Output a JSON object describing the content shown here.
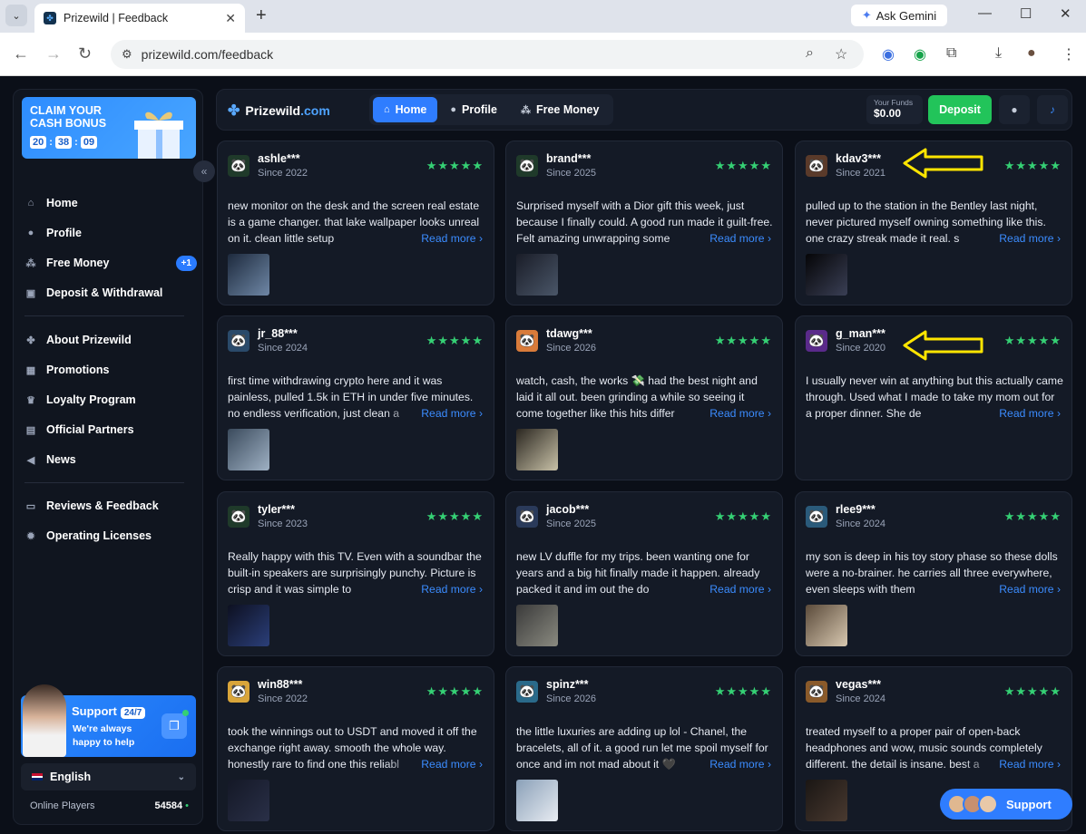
{
  "browser": {
    "tab_title": "Prizewild | Feedback",
    "url": "prizewild.com/feedback",
    "gemini_label": "Ask Gemini"
  },
  "sidebar": {
    "bonus_title": "CLAIM YOUR CASH BONUS",
    "timer": [
      "20",
      "38",
      "09"
    ],
    "items": [
      {
        "label": "Home",
        "icon": "home-icon"
      },
      {
        "label": "Profile",
        "icon": "user-icon"
      },
      {
        "label": "Free Money",
        "icon": "coins-icon",
        "badge": "+1"
      },
      {
        "label": "Deposit & Withdrawal",
        "icon": "wallet-icon"
      },
      {
        "label": "About Prizewild",
        "icon": "clover-icon"
      },
      {
        "label": "Promotions",
        "icon": "gift-icon"
      },
      {
        "label": "Loyalty Program",
        "icon": "trophy-icon"
      },
      {
        "label": "Official Partners",
        "icon": "briefcase-icon"
      },
      {
        "label": "News",
        "icon": "megaphone-icon"
      },
      {
        "label": "Reviews & Feedback",
        "icon": "chat-icon"
      },
      {
        "label": "Operating Licenses",
        "icon": "badge-icon"
      }
    ],
    "support_title": "Support",
    "support_badge": "24/7",
    "support_sub": "We're always happy to help",
    "language": "English",
    "online_label": "Online Players",
    "online_count": "54584"
  },
  "topbar": {
    "logo_main": "Prizewild",
    "logo_suffix": ".com",
    "tabs": [
      {
        "label": "Home",
        "icon": "home-icon",
        "active": true
      },
      {
        "label": "Profile",
        "icon": "user-icon",
        "active": false
      },
      {
        "label": "Free Money",
        "icon": "coins-icon",
        "active": false
      }
    ],
    "funds_label": "Your Funds",
    "funds_value": "$0.00",
    "deposit_label": "Deposit"
  },
  "reviews": [
    {
      "user": "ashle***",
      "since": "Since 2022",
      "text": "new monitor on the desk and the screen real estate is a game changer. that lake wallpaper looks unreal on it. clean little setup",
      "avatar_color": "#1f3a2a",
      "thumb_colors": [
        "#1d2a3d",
        "#6f87a6"
      ]
    },
    {
      "user": "brand***",
      "since": "Since 2025",
      "text": "Surprised myself with a Dior gift this week, just because I finally could. A good run made it guilt-free. Felt amazing unwrapping some",
      "avatar_color": "#1f3a2a",
      "thumb_colors": [
        "#1a1d28",
        "#4a5668"
      ]
    },
    {
      "user": "kdav3***",
      "since": "Since 2021",
      "text": "pulled up to the station in the Bentley last night, never pictured myself owning something like this. one crazy streak made it real. s",
      "avatar_color": "#5a3a2a",
      "thumb_colors": [
        "#050507",
        "#3a3f55"
      ]
    },
    {
      "user": "jr_88***",
      "since": "Since 2024",
      "text": "first time withdrawing crypto here and it was painless, pulled 1.5k in ETH in under five minutes. no endless verification, just clean a",
      "avatar_color": "#2a4a6a",
      "thumb_colors": [
        "#3a4a5c",
        "#9fb1c4"
      ]
    },
    {
      "user": "tdawg***",
      "since": "Since 2026",
      "text": "watch, cash, the works 💸 had the best night and laid it all out. been grinding a while so seeing it come together like this hits differ",
      "avatar_color": "#d97b3a",
      "thumb_colors": [
        "#2a2620",
        "#c9c2a8"
      ]
    },
    {
      "user": "g_man***",
      "since": "Since 2020",
      "text": "I usually never win at anything but this actually came through. Used what I made to take my mom out for a proper dinner. She de",
      "avatar_color": "#5a2a8a",
      "thumb_colors": [
        "#141a26",
        "#141a26"
      ]
    },
    {
      "user": "tyler***",
      "since": "Since 2023",
      "text": "Really happy with this TV. Even with a soundbar the built-in speakers are surprisingly punchy. Picture is crisp and it was simple to",
      "avatar_color": "#1f3a2a",
      "thumb_colors": [
        "#0d1020",
        "#2b3f7a"
      ]
    },
    {
      "user": "jacob***",
      "since": "Since 2025",
      "text": "new LV duffle for my trips. been wanting one for years and a big hit finally made it happen. already packed it and im out the do",
      "avatar_color": "#2a3a5a",
      "thumb_colors": [
        "#3a3a3a",
        "#8a8a80"
      ]
    },
    {
      "user": "rlee9***",
      "since": "Since 2024",
      "text": "my son is deep in his toy story phase so these dolls were a no-brainer. he carries all three everywhere, even sleeps with them",
      "avatar_color": "#2a5a7a",
      "thumb_colors": [
        "#5a4a3a",
        "#d8c8b0"
      ]
    },
    {
      "user": "win88***",
      "since": "Since 2022",
      "text": "took the winnings out to USDT and moved it off the exchange right away. smooth the whole way. honestly rare to find one this reliabl",
      "avatar_color": "#d9a53a",
      "thumb_colors": [
        "#141826",
        "#2a3048"
      ]
    },
    {
      "user": "spinz***",
      "since": "Since 2026",
      "text": "the little luxuries are adding up lol - Chanel, the bracelets, all of it. a good run let me spoil myself for once and im not mad about it 🖤",
      "avatar_color": "#2a6a8a",
      "thumb_colors": [
        "#8aa0b8",
        "#e8ecf2"
      ]
    },
    {
      "user": "vegas***",
      "since": "Since 2024",
      "text": "treated myself to a proper pair of open-back headphones and wow, music sounds completely different. the detail is insane. best a",
      "avatar_color": "#8a5a2a",
      "thumb_colors": [
        "#1a1614",
        "#4a3a30"
      ]
    }
  ],
  "ui": {
    "read_more": "Read more",
    "stars": "★★★★★",
    "support_float": "Support"
  },
  "colors": {
    "accent": "#2f7dff",
    "green": "#22c45a",
    "star": "#35d074",
    "annotation_arrow": "#ffe500"
  }
}
